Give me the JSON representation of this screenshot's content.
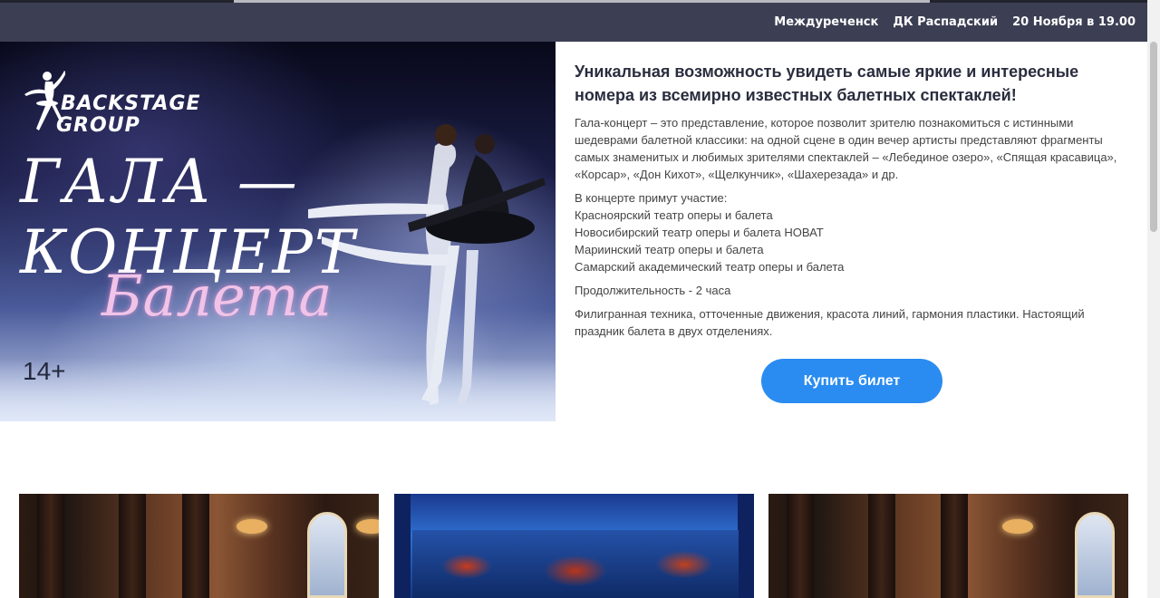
{
  "header": {
    "city": "Междуреченск",
    "venue": "ДК Распадский",
    "date_time": "20 Ноября в 19.00"
  },
  "poster": {
    "logo_line1": "BACKSTAGE",
    "logo_line2": "GROUP",
    "title_line1": "ГАЛА —",
    "title_line2": "КОНЦЕРТ",
    "title_line3": "Балета",
    "age_rating": "14+"
  },
  "content": {
    "headline": "Уникальная возможность увидеть самые яркие и интересные номера из всемирно известных балетных спектаклей!",
    "description": "Гала-концерт – это представление, которое позволит зрителю познакомиться с истинными шедеврами балетной классики: на одной сцене в один вечер артисты представляют фрагменты самых знаменитых и любимых зрителями спектаклей – «Лебединое озеро», «Спящая красавица», «Корсар», «Дон Кихот», «Щелкунчик», «Шахерезада» и др.",
    "participants_title": "В концерте примут участие:",
    "participants": [
      "Красноярский театр оперы и балета",
      "Новосибирский театр оперы и балета НОВАТ",
      "Мариинский театр оперы и балета",
      "Самарский академический театр оперы и балета"
    ],
    "duration": "Продолжительность - 2 часа",
    "closing": "Филигранная техника, отточенные движения, красота линий, гармония пластики. Настоящий праздник балета в двух отделениях."
  },
  "buy_button": {
    "label": "Купить билет",
    "color": "#2a8cf0"
  },
  "colors": {
    "header_bg": "#3c3f54",
    "header_text": "#ffffff"
  }
}
